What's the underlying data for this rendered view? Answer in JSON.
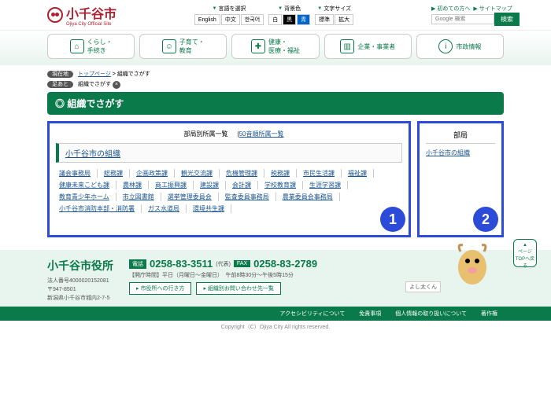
{
  "site": {
    "name": "小千谷市",
    "sub": "Ojiya City Official Site"
  },
  "settings": {
    "lang_label": "言語を選択",
    "langs": [
      "English",
      "中文",
      "한국어"
    ],
    "bg_label": "背景色",
    "bgs": [
      "白",
      "黒",
      "青"
    ],
    "size_label": "文字サイズ",
    "sizes": [
      "標準",
      "拡大"
    ]
  },
  "toplinks": {
    "first": "初めての方へ",
    "sitemap": "サイトマップ"
  },
  "search": {
    "placeholder": "Google 検索",
    "btn": "検索"
  },
  "nav": [
    {
      "l1": "くらし・",
      "l2": "手続き"
    },
    {
      "l1": "子育て・",
      "l2": "教育"
    },
    {
      "l1": "健康・",
      "l2": "医療・福祉"
    },
    {
      "l1": "企業・事業者",
      "l2": ""
    },
    {
      "l1": "市政情報",
      "l2": ""
    }
  ],
  "bc": {
    "here": "現在地",
    "top": "トップページ",
    "cur": "組織でさがす",
    "trace": "足あと"
  },
  "title": "組織でさがす",
  "tabs": {
    "t1": "部局別所属一覧",
    "t2": "50音順所属一覧"
  },
  "section": "小千谷市の組織",
  "links": [
    "議会事務局",
    "総務課",
    "企画政策課",
    "観光交流課",
    "危機管理課",
    "税務課",
    "市民生活課",
    "福祉課",
    "健康未来こども課",
    "農林課",
    "商工振興課",
    "建設課",
    "会計課",
    "学校教育課",
    "生涯学習課",
    "教育青少年ホーム",
    "市立図書館",
    "選挙管理委員会",
    "監査委員事務局",
    "農業委員会事務局",
    "小千谷市消防本部・消防署",
    "ガス水道局",
    "環境共生課"
  ],
  "side": {
    "h": "部局",
    "link": "小千谷市の組織"
  },
  "badges": {
    "one": "1",
    "two": "2"
  },
  "footer": {
    "office": "小千谷市役所",
    "corp": "法人番号4000020152081",
    "zip": "〒947-8501",
    "addr": "新潟県小千谷市城内2-7-5",
    "tel_label": "電話",
    "tel": "0258-83-3511",
    "tel_note": "(代表)",
    "fax_label": "FAX",
    "fax": "0258-83-2789",
    "hours": "【開庁時間】平日（月曜日～金曜日）　午前8時30分～午後5時15分",
    "btn1": "市役所への行き方",
    "btn2": "組織別お問い合わせ先一覧",
    "mascot": "よし太くん",
    "links": [
      "アクセシビリティについて",
      "免責事項",
      "個人情報の取り扱いについて",
      "著作権"
    ],
    "copy": "Copyright（C）Ojiya City All rights reserved."
  },
  "totop": "ページTOPへ戻る"
}
